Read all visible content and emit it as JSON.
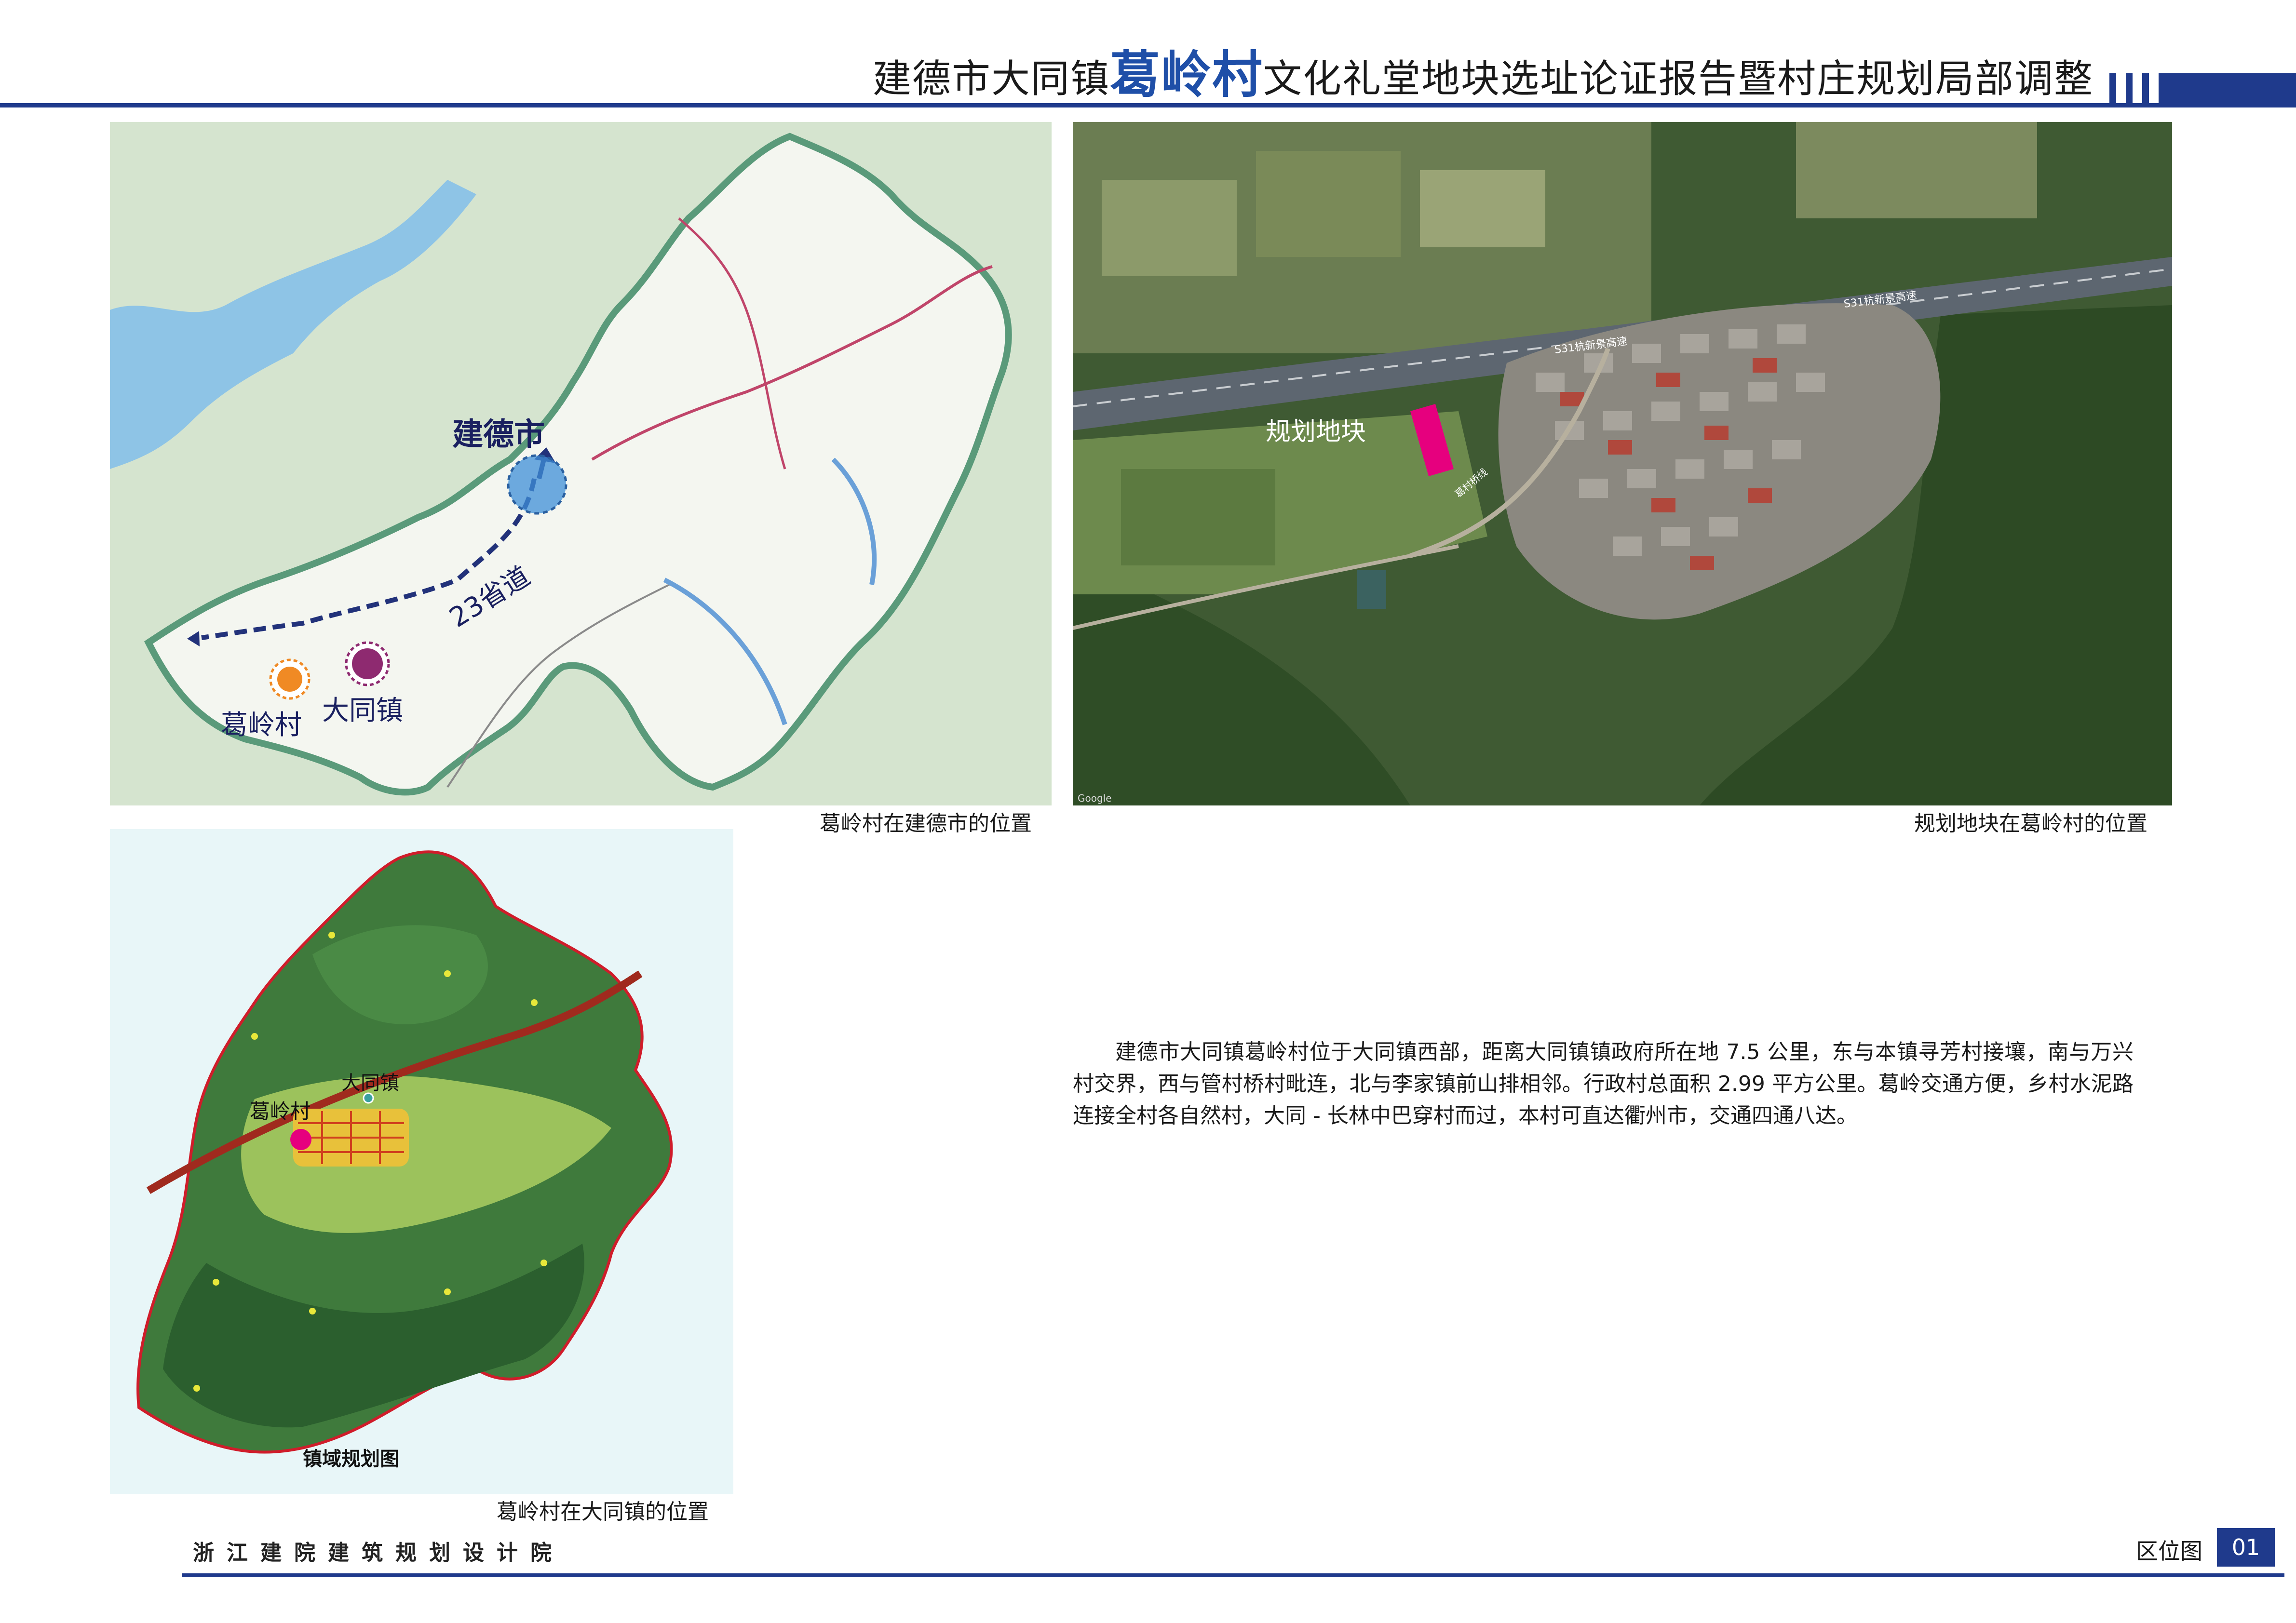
{
  "header": {
    "title_prefix": "建德市大同镇",
    "title_highlight": "葛岭村",
    "title_suffix": "文化礼堂地块选址论证报告暨村庄规划局部调整"
  },
  "maps": {
    "city": {
      "caption": "葛岭村在建德市的位置",
      "labels": {
        "city": "建德市",
        "town": "大同镇",
        "village": "葛岭村",
        "road": "23省道"
      }
    },
    "satellite": {
      "caption": "规划地块在葛岭村的位置",
      "labels": {
        "plot": "规划地块",
        "highway_1": "S31杭新景高速",
        "highway_2": "S31杭新景高速",
        "road": "葛村桥线",
        "credit": "Google"
      }
    },
    "town": {
      "caption": "葛岭村在大同镇的位置",
      "title": "镇域规划图",
      "labels": {
        "town": "大同镇",
        "village": "葛岭村"
      }
    }
  },
  "description": "建德市大同镇葛岭村位于大同镇西部，距离大同镇镇政府所在地 7.5 公里，东与本镇寻芳村接壤，南与万兴村交界，西与管村桥村毗连，北与李家镇前山排相邻。行政村总面积 2.99 平方公里。葛岭交通方便，乡村水泥路连接全村各自然村，大同 - 长林中巴穿村而过，本村可直达衢州市，交通四通八达。",
  "footer": {
    "org": "浙江建院建筑规划设计院",
    "section": "区位图",
    "page": "01"
  },
  "colors": {
    "brand_blue": "#1f3a8c",
    "plot_magenta": "#e6007e",
    "town_purple": "#8e2a70",
    "village_orange": "#f08a24",
    "city_blue": "#3f8fd8"
  }
}
